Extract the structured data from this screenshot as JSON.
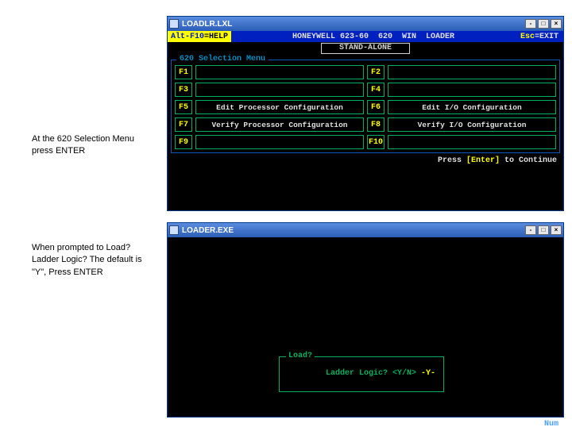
{
  "captions": {
    "c1": "At the 620 Selection Menu press ENTER",
    "c2": "When prompted to Load? Ladder Logic? The default is \"Y\", Press ENTER"
  },
  "win1": {
    "title": "LOADLR.LXL",
    "btn_min": "-",
    "btn_max": "□",
    "btn_close": "×",
    "alt_key": "Alt-F10",
    "alt_eq": "=HELP",
    "hb_mid_a": "HONEYWELL 623-60",
    "hb_mid_b": "620",
    "hb_mid_c": "WIN",
    "hb_mid_d": "LOADER",
    "esc_key": "Esc",
    "esc_eq": "=EXIT",
    "standalone": "STAND-ALONE",
    "menu_title": "620 Selection Menu",
    "fkeys": {
      "f1": {
        "k": "F1",
        "v": ""
      },
      "f2": {
        "k": "F2",
        "v": ""
      },
      "f3": {
        "k": "F3",
        "v": ""
      },
      "f4": {
        "k": "F4",
        "v": ""
      },
      "f5": {
        "k": "F5",
        "v": "Edit Processor Configuration"
      },
      "f6": {
        "k": "F6",
        "v": "Edit I/O Configuration"
      },
      "f7": {
        "k": "F7",
        "v": "Verify Processor Configuration"
      },
      "f8": {
        "k": "F8",
        "v": "Verify I/O Configuration"
      },
      "f9": {
        "k": "F9",
        "v": ""
      },
      "f10": {
        "k": "F10",
        "v": ""
      }
    },
    "press1": "Press ",
    "press2": "[Enter]",
    "press3": " to Continue"
  },
  "win2": {
    "title": "LOADER.EXE",
    "btn_min": "-",
    "btn_max": "□",
    "btn_close": "×",
    "load_title": "Load?",
    "load_line_a": "Ladder Logic? <Y/N> ",
    "load_line_b": "-Y-",
    "numlock": "Num"
  }
}
